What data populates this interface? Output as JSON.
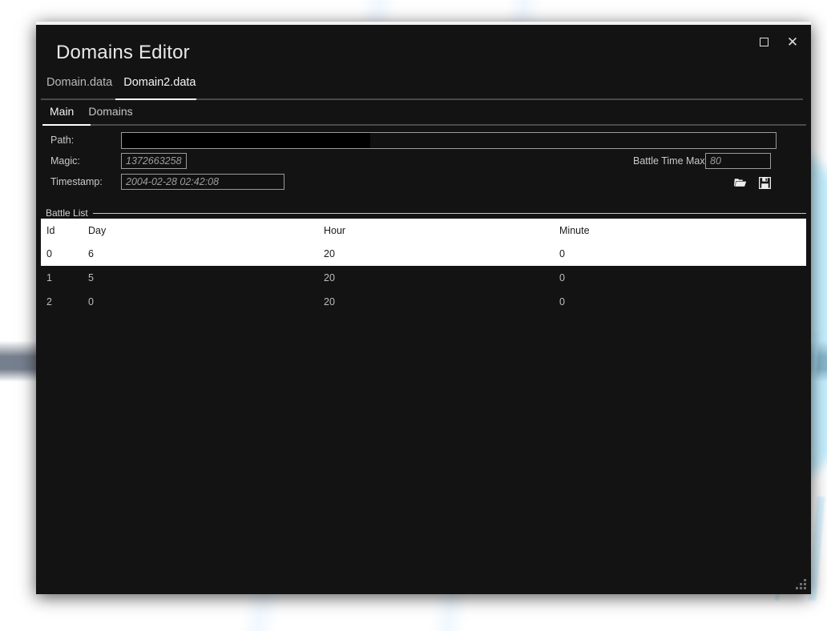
{
  "window": {
    "title": "Domains Editor",
    "controls": {
      "maximize_label": "□",
      "close_label": "✕"
    }
  },
  "file_tabs": [
    {
      "label": "Domain.data",
      "active": false
    },
    {
      "label": "Domain2.data",
      "active": true
    }
  ],
  "section_tabs": [
    {
      "label": "Main",
      "active": true
    },
    {
      "label": "Domains",
      "active": false
    }
  ],
  "form": {
    "path": {
      "label": "Path:",
      "value": "",
      "placeholder": ""
    },
    "magic": {
      "label": "Magic:",
      "value": "1372663258"
    },
    "timestamp": {
      "label": "Timestamp:",
      "value": "2004-02-28 02:42:08"
    },
    "battle_time_max": {
      "label": "Battle Time Max:",
      "value": "80"
    },
    "open_icon": "open-folder-icon",
    "save_icon": "floppy-save-icon"
  },
  "battle_list": {
    "group_label": "Battle List",
    "columns": [
      "Id",
      "Day",
      "Hour",
      "Minute"
    ],
    "rows": [
      {
        "id": "0",
        "day": "6",
        "hour": "20",
        "minute": "0",
        "selected": true
      },
      {
        "id": "1",
        "day": "5",
        "hour": "20",
        "minute": "0",
        "selected": false
      },
      {
        "id": "2",
        "day": "0",
        "hour": "20",
        "minute": "0",
        "selected": false
      }
    ]
  },
  "colors": {
    "window_background": "#131313",
    "window_top_border": "#f2f2f2",
    "text_primary": "#e9e9e9",
    "text_secondary": "#b9b9b9",
    "selection_background": "#ffffff",
    "selection_text": "#1a1a1a",
    "field_border": "#9a9a9a",
    "desktop": "#0a3a72"
  }
}
